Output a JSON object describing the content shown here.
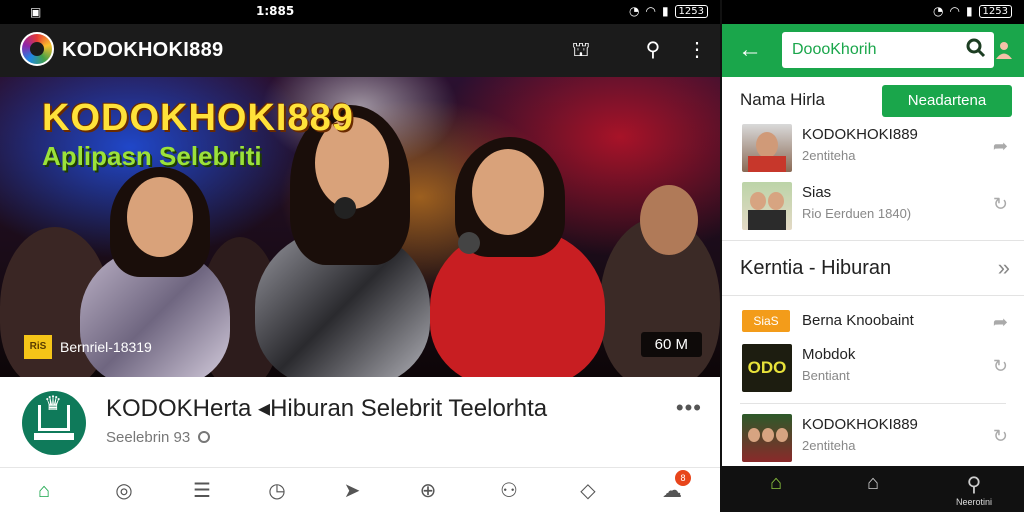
{
  "left_status": {
    "time": "1:885",
    "battery": "1253"
  },
  "appbar": {
    "title": "KODOKHOKI889"
  },
  "hero": {
    "title": "KODOKHOKI889",
    "subtitle": "Aplipasn Selebriti",
    "badge_mark": "RiS",
    "badge_text": "Bernriel-18319",
    "duration": "60 M"
  },
  "channel": {
    "title": "KODOKHerta ◂Hiburan Selebrit Teelorhta",
    "subtitle": "Seelebrin 93",
    "more": "•••"
  },
  "bottom_nav": {
    "items": [
      {
        "name": "home",
        "glyph": "⌂"
      },
      {
        "name": "trending",
        "glyph": "◎"
      },
      {
        "name": "list",
        "glyph": "☰"
      },
      {
        "name": "clock",
        "glyph": "◷"
      },
      {
        "name": "send",
        "glyph": "➤"
      },
      {
        "name": "add",
        "glyph": "⊕"
      },
      {
        "name": "profile",
        "glyph": "⚇"
      },
      {
        "name": "messages",
        "glyph": "◇"
      },
      {
        "name": "notifications",
        "glyph": "☁"
      }
    ],
    "notif_count": "8"
  },
  "right_status": {
    "battery": "1253"
  },
  "right_appbar": {
    "search_text": "DoooKhorih"
  },
  "right_section": {
    "heading": "Nama Hirla",
    "button": "Neadartena"
  },
  "right_list_top": [
    {
      "name": "KODOKHOKI889",
      "meta": "2entiteha"
    },
    {
      "name": "Sias",
      "meta": "Rio Eerduen 1840)"
    }
  ],
  "big_row": {
    "title": "Kerntia - Hiburan",
    "chevron": "»"
  },
  "right_list_bottom": [
    {
      "name": "Berna Knoobaint",
      "meta": "",
      "thumb_label": "SiaS"
    },
    {
      "name": "Mobdok",
      "meta": "Bentiant",
      "thumb_label": "ODO"
    },
    {
      "name": "KODOKHOKI889",
      "meta": "2entiteha",
      "thumb_label": ""
    }
  ],
  "right_bottom_nav": {
    "search_label": "Neerotini"
  },
  "colors": {
    "accent_green": "#1aa64b",
    "hero_yellow": "#ffe23a",
    "hero_green": "#9be23a"
  }
}
